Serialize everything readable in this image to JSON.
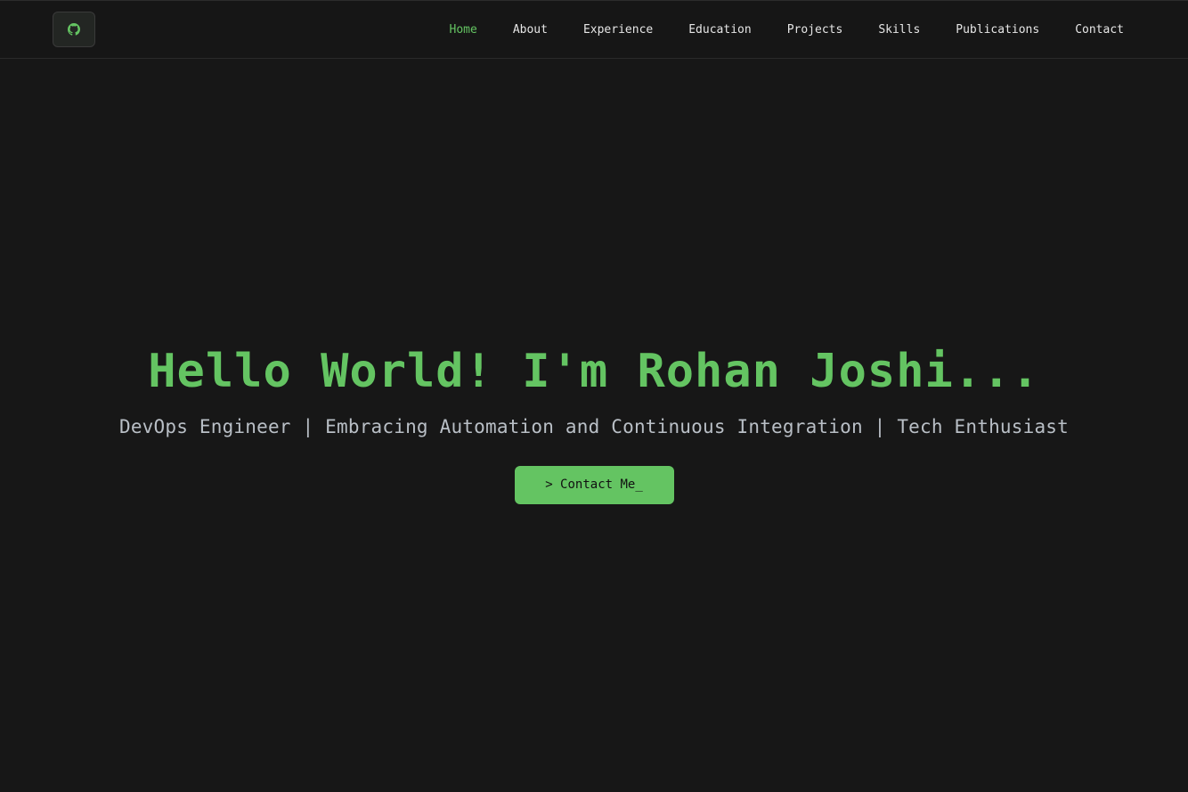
{
  "navbar": {
    "logo_icon": "github-icon",
    "links": [
      {
        "label": "Home",
        "active": true
      },
      {
        "label": "About",
        "active": false
      },
      {
        "label": "Experience",
        "active": false
      },
      {
        "label": "Education",
        "active": false
      },
      {
        "label": "Projects",
        "active": false
      },
      {
        "label": "Skills",
        "active": false
      },
      {
        "label": "Publications",
        "active": false
      },
      {
        "label": "Contact",
        "active": false
      }
    ]
  },
  "hero": {
    "title": "Hello World! I'm Rohan Joshi...",
    "subtitle": "DevOps Engineer | Embracing Automation and Continuous Integration | Tech Enthusiast",
    "cta_label": "> Contact Me_"
  },
  "colors": {
    "background": "#171717",
    "accent": "#64c462",
    "nav_text": "#e6e6e6",
    "subtitle_text": "#b9bfc6"
  }
}
